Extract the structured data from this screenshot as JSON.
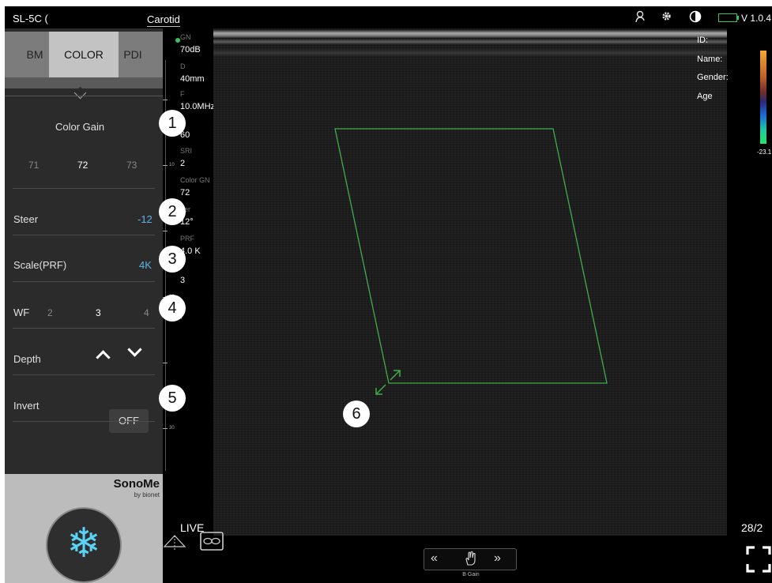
{
  "header": {
    "probe": "SL-5C (",
    "preset": "Carotid",
    "version": "V 1.0.4",
    "icons": [
      "user-icon",
      "gear-icon",
      "contrast-icon",
      "battery-icon"
    ],
    "battery_color": "#35c35b"
  },
  "modes": [
    {
      "label": "BM",
      "active": false
    },
    {
      "label": "COLOR",
      "active": true
    },
    {
      "label": "PDI",
      "active": false
    }
  ],
  "controls": {
    "color_gain": {
      "label": "Color Gain",
      "values": [
        "71",
        "72",
        "73"
      ],
      "selected": "72"
    },
    "steer": {
      "label": "Steer",
      "value": "-12"
    },
    "scale": {
      "label": "Scale(PRF)",
      "value": "4K"
    },
    "wf": {
      "label": "WF",
      "values": [
        "2",
        "3",
        "4"
      ],
      "selected": "3"
    },
    "depth": {
      "label": "Depth"
    },
    "invert": {
      "label": "Invert",
      "value": "OFF"
    }
  },
  "brand": {
    "name": "SonoMe",
    "sub": "by bionet"
  },
  "params": [
    {
      "label": "GN",
      "value": "70dB"
    },
    {
      "label": "D",
      "value": "40mm"
    },
    {
      "label": "F",
      "value": "10.0MHz"
    },
    {
      "label": "",
      "value": "60"
    },
    {
      "label": "SRI",
      "value": "2"
    },
    {
      "label": "Color GN",
      "value": "72"
    },
    {
      "label": "eer",
      "value": "12°"
    },
    {
      "label": "PRF",
      "value": "4.0 K"
    },
    {
      "label": "",
      "value": "3"
    }
  ],
  "scale_marks": [
    "10",
    "20",
    "30"
  ],
  "patient": {
    "id": "ID:",
    "name": "Name:",
    "gender": "Gender:",
    "age": "Age"
  },
  "colorbar": {
    "bottom_label": "-23.1"
  },
  "status": {
    "live": "LIVE",
    "frame": "28/2"
  },
  "gain_control": {
    "left": "«",
    "right": "»",
    "label": "B Gain"
  },
  "callouts": [
    "1",
    "2",
    "3",
    "4",
    "5",
    "6"
  ],
  "accent_colors": {
    "roi": "#3fae4a",
    "value_blue": "#5ab3ea",
    "freeze": "#5ad3f6"
  }
}
